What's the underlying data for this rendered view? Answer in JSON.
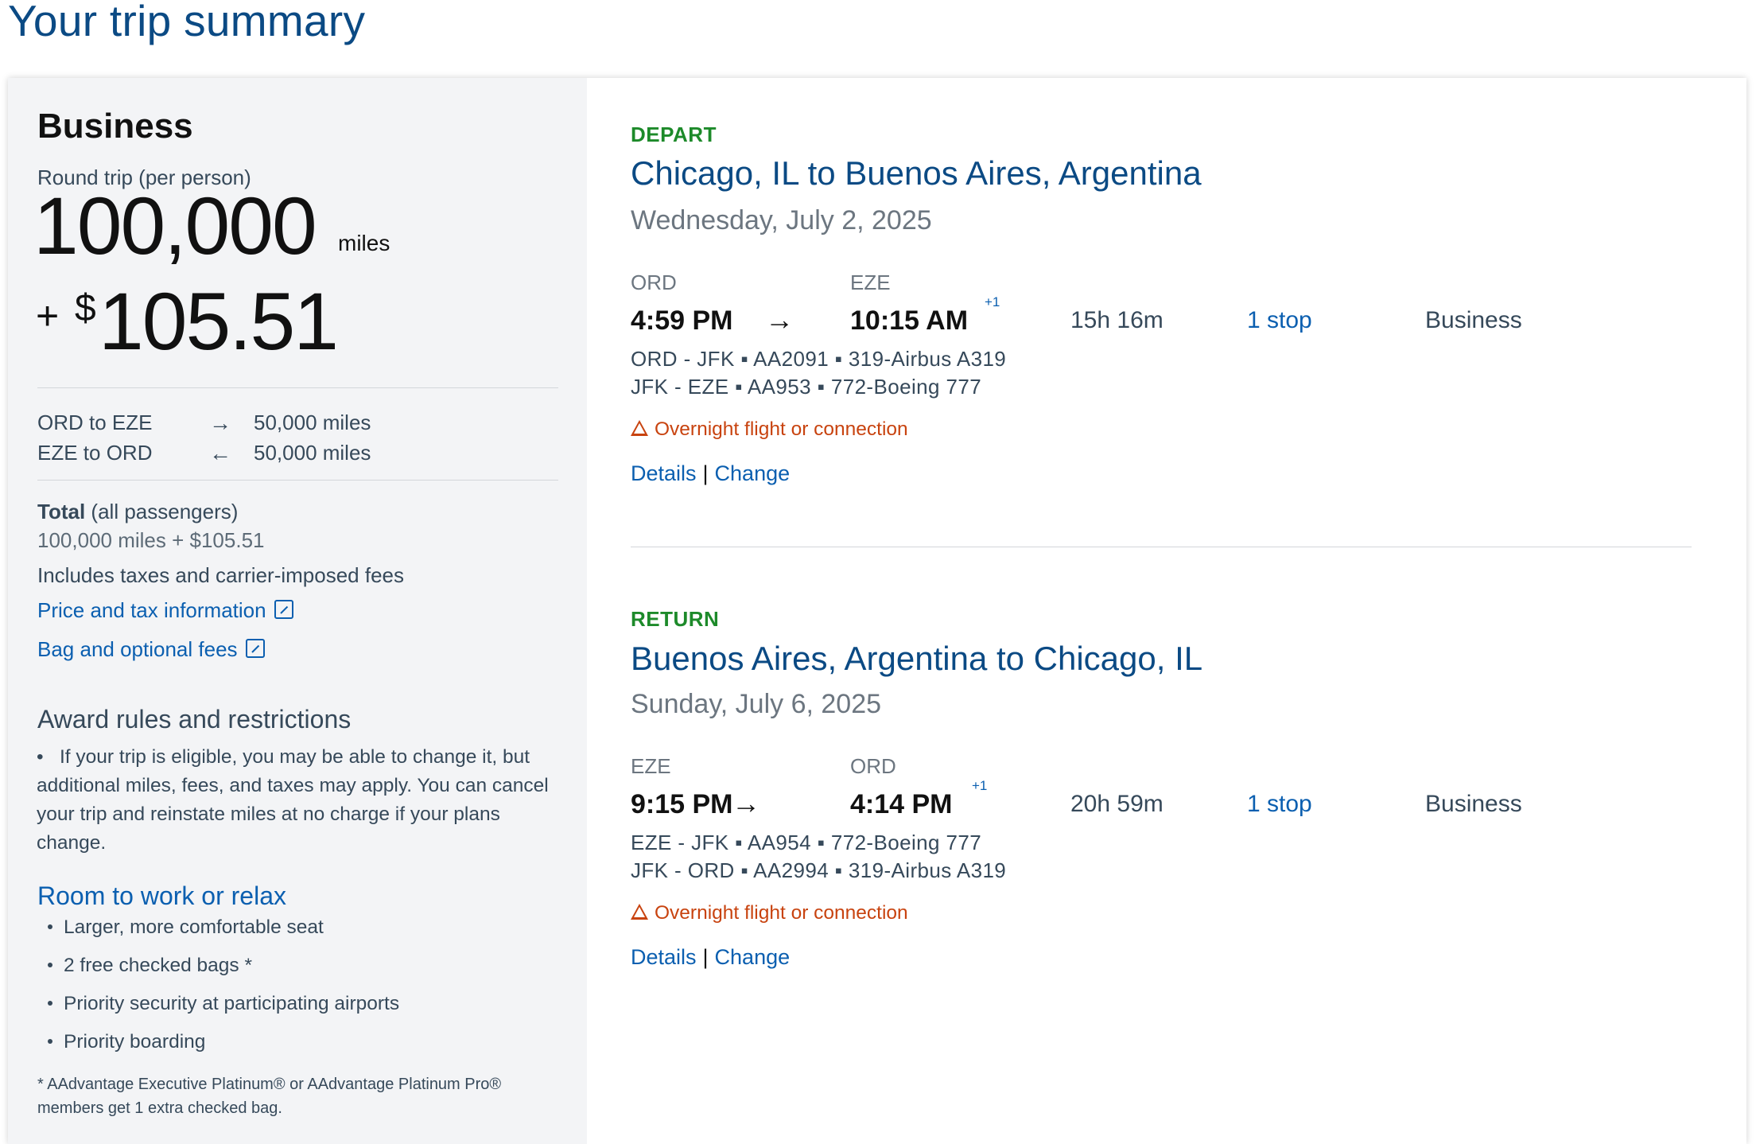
{
  "page": {
    "title": "Your trip summary"
  },
  "summary": {
    "cabin": "Business",
    "trip_type": "Round trip (per person)",
    "miles": "100,000",
    "miles_unit": "miles",
    "plus": "+",
    "currency_symbol": "$",
    "cash": "105.51",
    "segments": [
      {
        "route": "ORD to EZE",
        "arrow": "→",
        "miles": "50,000 miles"
      },
      {
        "route": "EZE to ORD",
        "arrow": "←",
        "miles": "50,000 miles"
      }
    ],
    "total_label": "Total",
    "total_suffix": "(all passengers)",
    "total_value": "100,000 miles + $105.51",
    "fees_note": "Includes taxes and carrier-imposed fees",
    "price_tax_link": "Price and tax information",
    "bag_fees_link": "Bag and optional fees",
    "rules_title": "Award rules and restrictions",
    "rules_text": "If your trip is eligible, you may be able to change it, but additional miles, fees, and taxes may apply. You can cancel your trip and reinstate miles at no charge if your plans change.",
    "benefits_title": "Room to work or relax",
    "benefits": [
      "Larger, more comfortable seat",
      "2 free checked bags *",
      "Priority security at participating airports",
      "Priority boarding"
    ],
    "footnote": "* AAdvantage Executive Platinum® or AAdvantage Platinum Pro® members get 1 extra checked bag."
  },
  "flights": [
    {
      "direction": "DEPART",
      "route": "Chicago, IL to Buenos Aires, Argentina",
      "date": "Wednesday, July 2, 2025",
      "origin": "ORD",
      "destination": "EZE",
      "depart_time": "4:59 PM",
      "arrive_time": "10:15 AM",
      "day_offset": "+1",
      "duration": "15h 16m",
      "stops": "1 stop",
      "cabin": "Business",
      "segments": [
        "ORD - JFK ▪ AA2091 ▪ 319-Airbus A319",
        "JFK - EZE ▪ AA953 ▪ 772-Boeing 777"
      ],
      "warning": "Overnight flight or connection",
      "details_label": "Details",
      "separator": "|",
      "change_label": "Change"
    },
    {
      "direction": "RETURN",
      "route": "Buenos Aires, Argentina to Chicago, IL",
      "date": "Sunday, July 6, 2025",
      "origin": "EZE",
      "destination": "ORD",
      "depart_time": "9:15 PM",
      "arrive_time": "4:14 PM",
      "day_offset": "+1",
      "duration": "20h 59m",
      "stops": "1 stop",
      "cabin": "Business",
      "segments": [
        "EZE - JFK ▪ AA954 ▪ 772-Boeing 777",
        "JFK - ORD ▪ AA2994 ▪ 319-Airbus A319"
      ],
      "warning": "Overnight flight or connection",
      "details_label": "Details",
      "separator": "|",
      "change_label": "Change"
    }
  ]
}
